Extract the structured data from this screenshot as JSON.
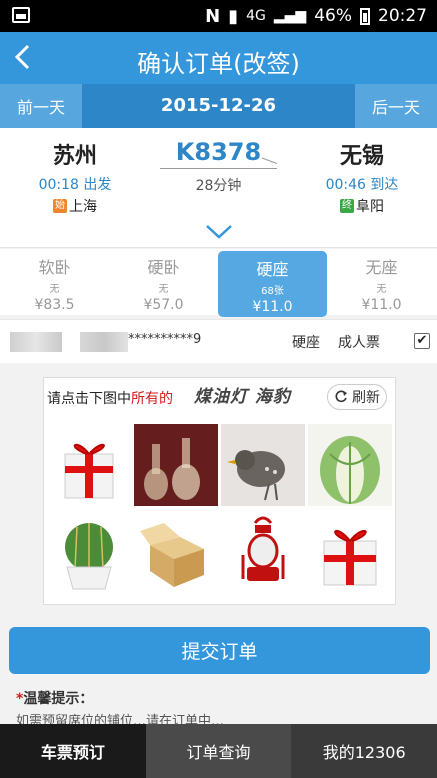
{
  "status_bar": {
    "network": "4G",
    "battery": "46%",
    "time": "20:27"
  },
  "header": {
    "back_icon": "chevron-left-icon",
    "title": "确认订单(改签)"
  },
  "date_bar": {
    "prev": "前一天",
    "date": "2015-12-26",
    "next": "后一天"
  },
  "train": {
    "from": {
      "name": "苏州",
      "time": "00:18 出发",
      "badge": "始",
      "origin": "上海"
    },
    "number": "K8378",
    "duration": "28分钟",
    "to": {
      "name": "无锡",
      "time": "00:46 到达",
      "badge": "终",
      "terminal": "阜阳"
    }
  },
  "seats": [
    {
      "type": "软卧",
      "count": "无",
      "price": "¥83.5"
    },
    {
      "type": "硬卧",
      "count": "无",
      "price": "¥57.0"
    },
    {
      "type": "硬座",
      "count": "68张",
      "price": "¥11.0"
    },
    {
      "type": "无座",
      "count": "无",
      "price": "¥11.0"
    }
  ],
  "passenger": {
    "id_masked": "**********9",
    "seat": "硬座",
    "ticket_type": "成人票",
    "checked": "✔"
  },
  "captcha": {
    "prompt_prefix": "请点击下图中",
    "prompt_highlight": "所有的",
    "target_words": "煤油灯 海豹",
    "refresh_label": "刷新",
    "tiles": [
      "gift-box",
      "glass-vases",
      "bird",
      "cabbage",
      "cactus",
      "cardboard-box",
      "oil-lamp",
      "gift-box"
    ]
  },
  "submit_label": "提交订单",
  "tips": {
    "title_star": "*",
    "title": "温馨提示：",
    "line1": "如需预留席位的铺位…请在订单中…"
  },
  "tabs": [
    "车票预订",
    "订单查询",
    "我的12306"
  ]
}
